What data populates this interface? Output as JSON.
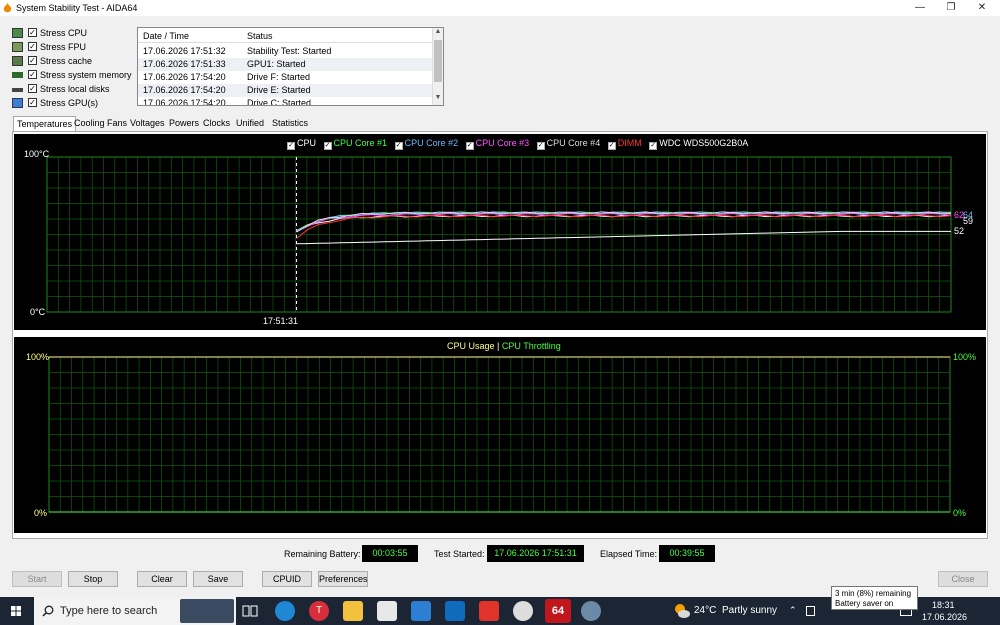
{
  "window": {
    "title": "System Stability Test - AIDA64",
    "minimize": "—",
    "maximize": "❐",
    "close": "✕"
  },
  "stress": [
    {
      "label": "Stress CPU",
      "checked": "✓",
      "icon": "cpu-chip-icon"
    },
    {
      "label": "Stress FPU",
      "checked": "✓",
      "icon": "fpu-chip-icon"
    },
    {
      "label": "Stress cache",
      "checked": "✓",
      "icon": "cache-chip-icon"
    },
    {
      "label": "Stress system memory",
      "checked": "✓",
      "icon": "memory-module-icon"
    },
    {
      "label": "Stress local disks",
      "checked": "✓",
      "icon": "disk-icon"
    },
    {
      "label": "Stress GPU(s)",
      "checked": "✓",
      "icon": "monitor-icon"
    }
  ],
  "log": {
    "columns": [
      "Date / Time",
      "Status"
    ],
    "rows": [
      [
        "17.06.2026 17:51:32",
        "Stability Test: Started"
      ],
      [
        "17.06.2026 17:51:33",
        "GPU1: Started"
      ],
      [
        "17.06.2026 17:54:20",
        "Drive F: Started"
      ],
      [
        "17.06.2026 17:54:20",
        "Drive E: Started"
      ],
      [
        "17.06.2026 17:54:20",
        "Drive C: Started"
      ]
    ]
  },
  "tabs": [
    "Temperatures",
    "Cooling Fans",
    "Voltages",
    "Powers",
    "Clocks",
    "Unified",
    "Statistics"
  ],
  "temp_chart": {
    "legend": [
      {
        "name": "CPU",
        "color": "#ffffff"
      },
      {
        "name": "CPU Core #1",
        "color": "#44ff44"
      },
      {
        "name": "CPU Core #2",
        "color": "#66bbff"
      },
      {
        "name": "CPU Core #3",
        "color": "#ff55ff"
      },
      {
        "name": "CPU Core #4",
        "color": "#dddddd"
      },
      {
        "name": "DIMM",
        "color": "#ff3333"
      },
      {
        "name": "WDC WDS500G2B0A",
        "color": "#ffffff"
      }
    ],
    "y_top": "100°C",
    "y_bottom": "0°C",
    "marker_time": "17:51:31",
    "right_values": [
      "62",
      "64",
      "59",
      "52"
    ]
  },
  "usage_chart": {
    "legend_a": "CPU Usage",
    "sep": "|",
    "legend_b": "CPU Throttling",
    "y_top": "100%",
    "y_bottom": "0%",
    "y_top_r": "100%",
    "y_bottom_r": "0%"
  },
  "chart_data": [
    {
      "type": "line",
      "title": "",
      "ylim": [
        0,
        100
      ],
      "y_ticks": [
        "0°C",
        "100°C"
      ],
      "x_marker": "17:51:31",
      "legend_position": "top",
      "grid": true,
      "series": [
        {
          "name": "CPU",
          "end_value": 62
        },
        {
          "name": "CPU Core #1",
          "end_value": 64
        },
        {
          "name": "CPU Core #2",
          "end_value": 64
        },
        {
          "name": "CPU Core #3",
          "end_value": 63
        },
        {
          "name": "CPU Core #4",
          "end_value": 64
        },
        {
          "name": "DIMM",
          "end_value": 62
        },
        {
          "name": "WDC WDS500G2B0A",
          "end_value": 52
        }
      ]
    },
    {
      "type": "line",
      "title": "",
      "ylim": [
        0,
        100
      ],
      "y_ticks": [
        "0%",
        "100%"
      ],
      "legend_position": "top",
      "grid": true,
      "series": [
        {
          "name": "CPU Usage",
          "end_value": 100
        },
        {
          "name": "CPU Throttling",
          "end_value": 0
        }
      ]
    }
  ],
  "status": {
    "battery_label": "Remaining Battery:",
    "battery_value": "00:03:55",
    "started_label": "Test Started:",
    "started_value": "17.06.2026 17:51:31",
    "elapsed_label": "Elapsed Time:",
    "elapsed_value": "00:39:55"
  },
  "buttons": {
    "start": "Start",
    "stop": "Stop",
    "clear": "Clear",
    "save": "Save",
    "cpuid": "CPUID",
    "preferences": "Preferences",
    "close": "Close"
  },
  "tooltip": {
    "line1": "3 min (8%) remaining",
    "line2": "Battery saver on"
  },
  "taskbar": {
    "search_placeholder": "Type here to search",
    "weather_temp": "24°C",
    "weather_text": "Partly sunny",
    "time": "18:31",
    "date": "17.06.2026",
    "aida_label": "64"
  }
}
